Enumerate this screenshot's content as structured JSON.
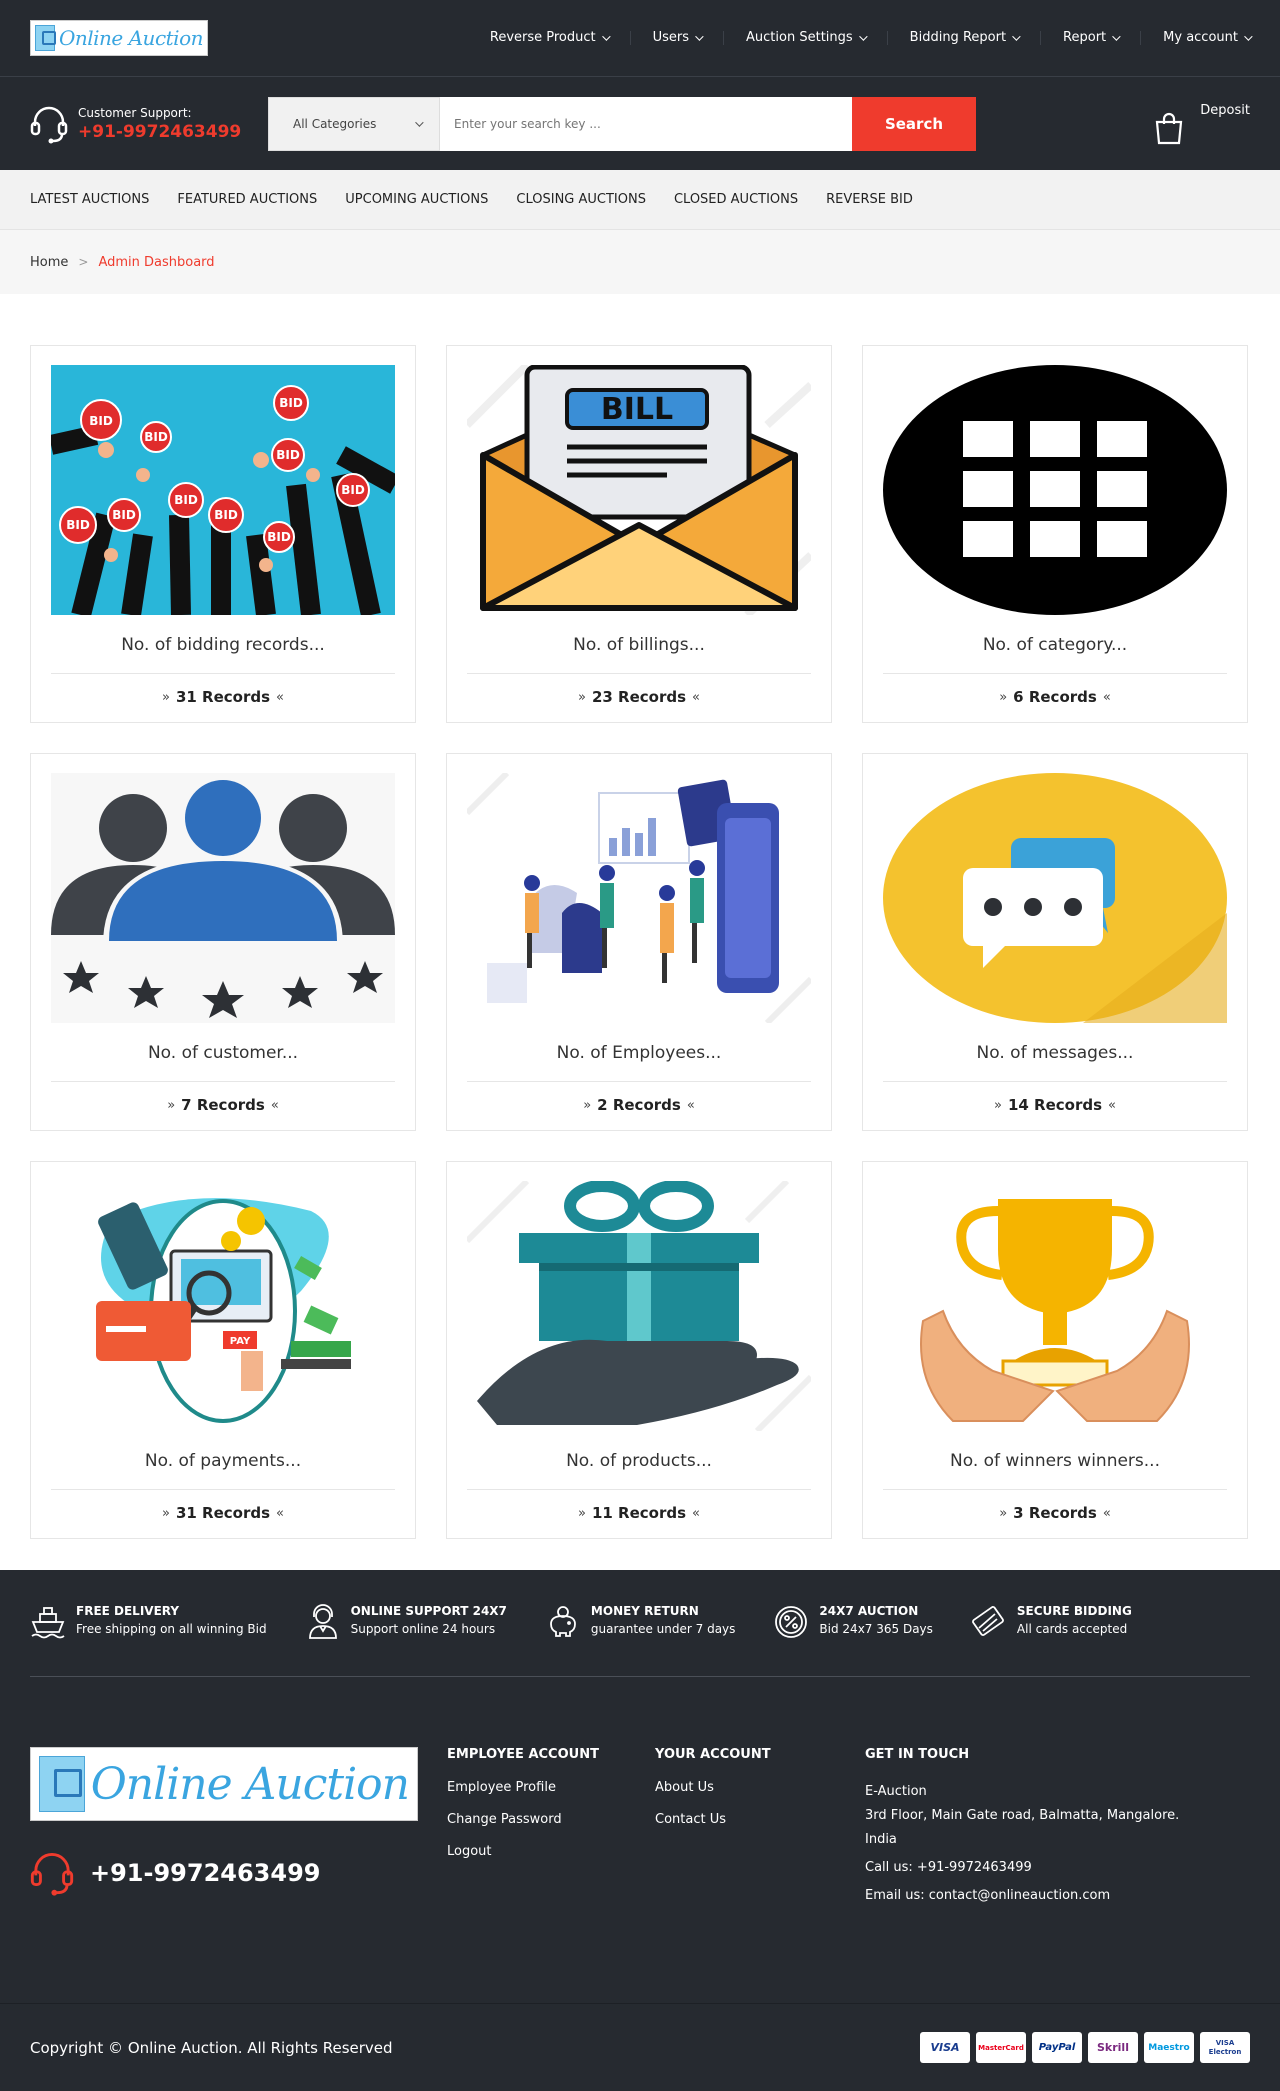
{
  "header": {
    "logo_text": "Online Auction",
    "nav": [
      {
        "label": "Reverse Product"
      },
      {
        "label": "Users"
      },
      {
        "label": "Auction Settings"
      },
      {
        "label": "Bidding Report"
      },
      {
        "label": "Report"
      },
      {
        "label": "My account"
      }
    ]
  },
  "support": {
    "label": "Customer Support:",
    "phone": "+91-9972463499"
  },
  "search": {
    "category_selected": "All Categories",
    "placeholder": "Enter your search key ...",
    "button_label": "Search"
  },
  "deposit_label": "Deposit",
  "category_nav": [
    "LATEST AUCTIONS",
    "FEATURED AUCTIONS",
    "UPCOMING AUCTIONS",
    "CLOSING AUCTIONS",
    "CLOSED AUCTIONS",
    "REVERSE BID"
  ],
  "breadcrumb": {
    "home": "Home",
    "separator": ">",
    "current": "Admin Dashboard"
  },
  "cards": [
    {
      "title": "No. of bidding records...",
      "count": "31 Records",
      "image": "bid-paddles",
      "bid_label": "BID"
    },
    {
      "title": "No. of billings...",
      "count": "23 Records",
      "image": "bill-envelope",
      "bill_label": "BILL"
    },
    {
      "title": "No. of category...",
      "count": "6 Records",
      "image": "category-grid"
    },
    {
      "title": "No. of customer...",
      "count": "7 Records",
      "image": "customer-rating"
    },
    {
      "title": "No. of Employees...",
      "count": "2 Records",
      "image": "employees-illustration"
    },
    {
      "title": "No. of messages...",
      "count": "14 Records",
      "image": "chat-bubbles"
    },
    {
      "title": "No. of payments...",
      "count": "31 Records",
      "image": "payment-illustration",
      "pay_label": "PAY"
    },
    {
      "title": "No. of products...",
      "count": "11 Records",
      "image": "gift-hand"
    },
    {
      "title": "No. of winners winners...",
      "count": "3 Records",
      "image": "trophy-hands"
    }
  ],
  "records_prefix": "»",
  "records_suffix": "«",
  "features": [
    {
      "title": "FREE DELIVERY",
      "sub": "Free shipping on all winning Bid",
      "icon": "ship-icon"
    },
    {
      "title": "ONLINE SUPPORT 24X7",
      "sub": "Support online 24 hours",
      "icon": "support-agent-icon"
    },
    {
      "title": "MONEY RETURN",
      "sub": "guarantee under 7 days",
      "icon": "piggy-bank-icon"
    },
    {
      "title": "24X7 AUCTION",
      "sub": "Bid 24x7 365 Days",
      "icon": "percent-badge-icon"
    },
    {
      "title": "SECURE BIDDING",
      "sub": "All cards accepted",
      "icon": "credit-card-icon"
    }
  ],
  "footer": {
    "logo_text": "Online Auction",
    "phone": "+91-9972463499",
    "employee_account": {
      "heading": "EMPLOYEE ACCOUNT",
      "links": [
        "Employee Profile",
        "Change Password",
        "Logout"
      ]
    },
    "your_account": {
      "heading": "YOUR ACCOUNT",
      "links": [
        "About Us",
        "Contact Us"
      ]
    },
    "contact": {
      "heading": "GET IN TOUCH",
      "company": "E-Auction",
      "address": "3rd Floor, Main Gate road, Balmatta, Mangalore. India",
      "call": "Call us: +91-9972463499",
      "email": "Email us: contact@onlineauction.com"
    },
    "copyright": "Copyright © Online Auction. All Rights Reserved",
    "payment_methods": [
      {
        "label": "VISA",
        "color": "#1a3d8f"
      },
      {
        "label": "MasterCard",
        "color": "#eb001b"
      },
      {
        "label": "PayPal",
        "color": "#003087"
      },
      {
        "label": "Skrill",
        "color": "#7b2a80"
      },
      {
        "label": "Maestro",
        "color": "#0099df"
      },
      {
        "label": "VISA Electron",
        "color": "#1a3d8f"
      }
    ]
  },
  "colors": {
    "accent": "#ef3b2d",
    "dark": "#262a30",
    "logo_blue": "#3aa5e0"
  }
}
